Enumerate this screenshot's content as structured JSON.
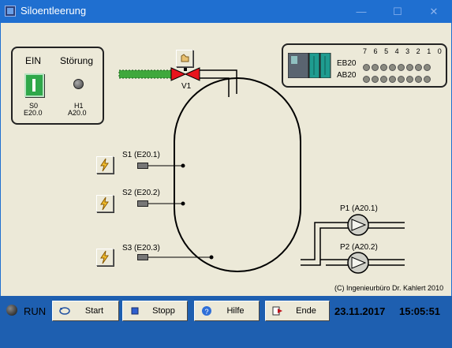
{
  "window": {
    "title": "Siloentleerung"
  },
  "ein_panel": {
    "ein_label": "EIN",
    "stoerung_label": "Störung",
    "s0_name": "S0",
    "s0_addr": "E20.0",
    "h1_name": "H1",
    "h1_addr": "A20.0"
  },
  "valve": {
    "label": "V1"
  },
  "io_panel": {
    "bit_labels": [
      "7",
      "6",
      "5",
      "4",
      "3",
      "2",
      "1",
      "0"
    ],
    "eb_label": "EB20",
    "ab_label": "AB20"
  },
  "sensors": [
    {
      "label": "S1 (E20.1)"
    },
    {
      "label": "S2 (E20.2)"
    },
    {
      "label": "S3 (E20.3)"
    }
  ],
  "pumps": [
    {
      "label": "P1 (A20.1)"
    },
    {
      "label": "P2 (A20.2)"
    }
  ],
  "copyright": "(C) Ingenieurbüro Dr. Kahlert 2010",
  "statusbar": {
    "run": "RUN",
    "start": "Start",
    "stopp": "Stopp",
    "hilfe": "Hilfe",
    "ende": "Ende",
    "date": "23.11.2017",
    "time": "15:05:51"
  },
  "colors": {
    "valve": "#e8141c",
    "feed_pipe": "#3fa83c",
    "status_bg": "#1e5fb0",
    "title_bg": "#1f6fd0"
  }
}
